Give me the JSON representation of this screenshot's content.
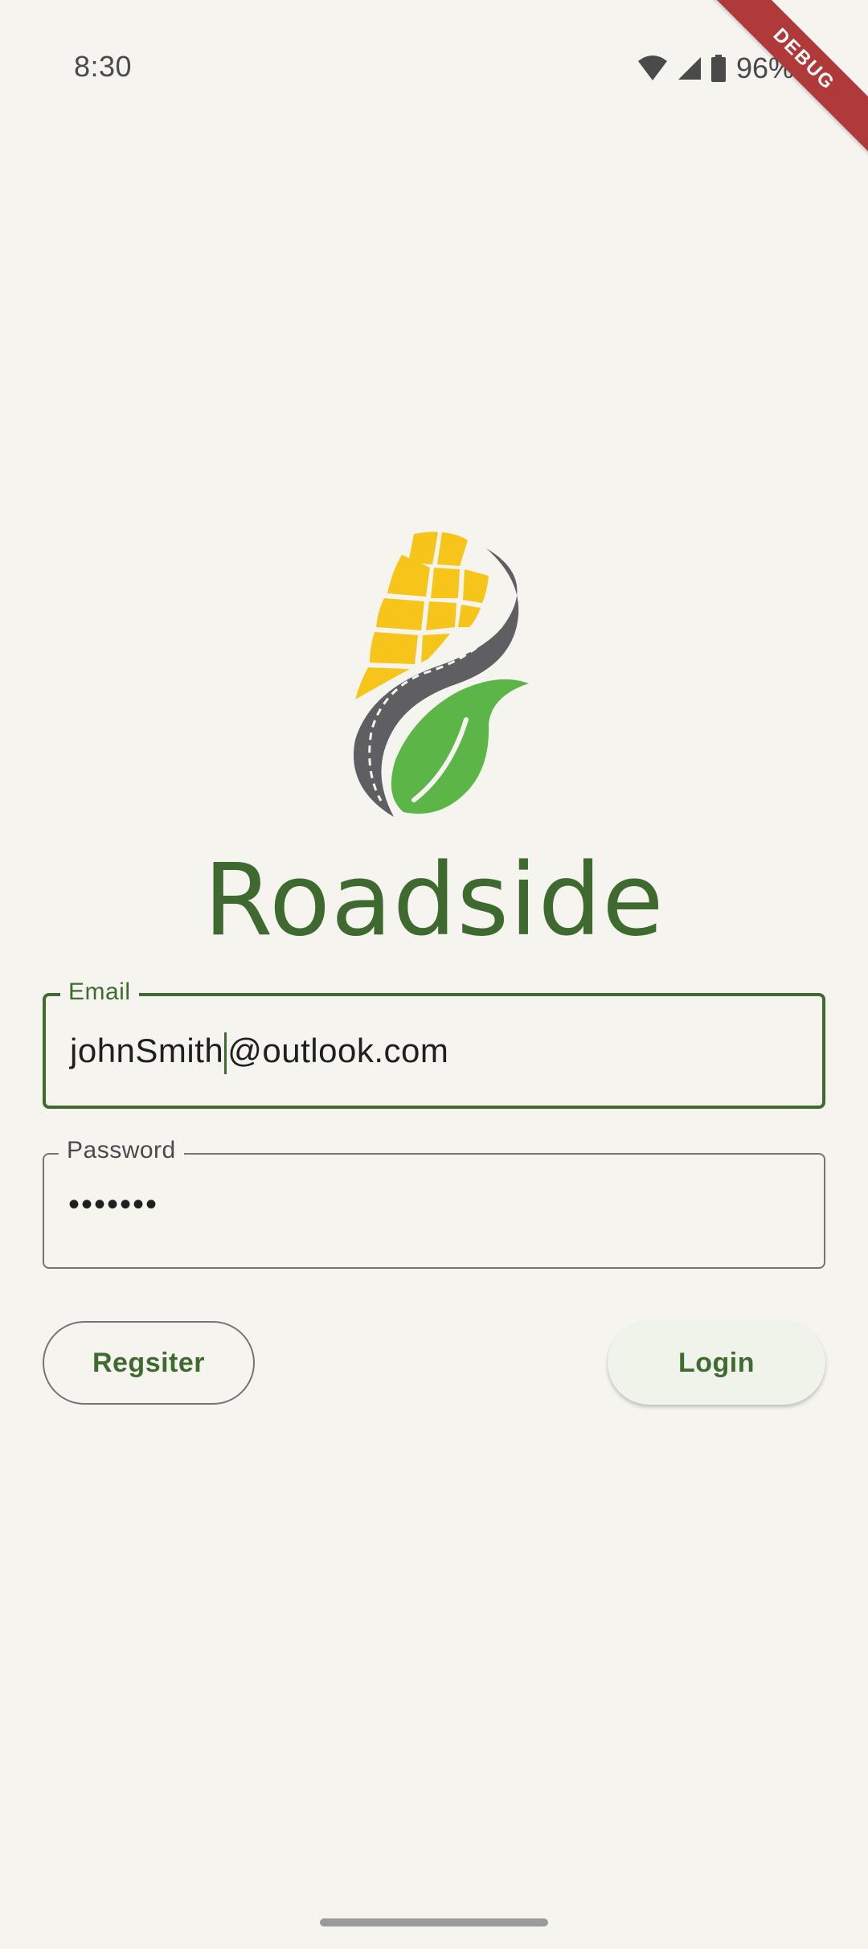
{
  "status_bar": {
    "time": "8:30",
    "battery": "96%",
    "icons": [
      "wifi-icon",
      "cellular-signal-icon",
      "battery-icon"
    ]
  },
  "debug_banner": "DEBUG",
  "brand": {
    "title": "Roadside",
    "color": "#3e6a2f",
    "logo_colors": {
      "corn": "#f7c41a",
      "road": "#5f5e62",
      "leaf": "#5cb547"
    }
  },
  "form": {
    "email": {
      "label": "Email",
      "value": "johnSmith@outlook.com",
      "value_before_cursor": "johnSmith",
      "value_after_cursor": "@outlook.com"
    },
    "password": {
      "label": "Password",
      "value": "•••••••"
    }
  },
  "buttons": {
    "register": "Regsiter",
    "login": "Login"
  },
  "colors": {
    "accent": "#3f6a30",
    "background": "#f5f4ef"
  }
}
